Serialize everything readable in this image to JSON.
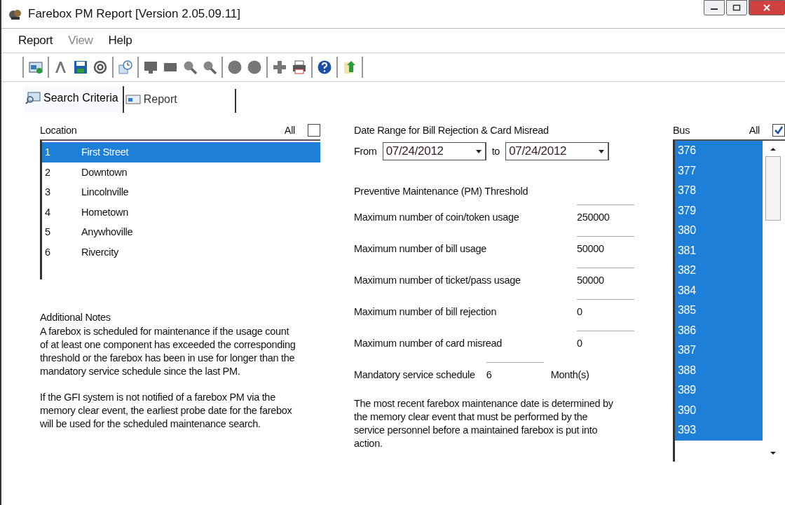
{
  "window": {
    "title": "Farebox PM Report [Version 2.05.09.11]"
  },
  "menu": [
    {
      "label": "Report",
      "disabled": false
    },
    {
      "label": "View",
      "disabled": true
    },
    {
      "label": "Help",
      "disabled": false
    }
  ],
  "tabs": [
    {
      "label": "Search Criteria",
      "selected": true
    },
    {
      "label": "Report",
      "selected": false
    }
  ],
  "location": {
    "label": "Location",
    "all_label": "All",
    "all_checked": false,
    "items": [
      {
        "number": "1",
        "name": "First Street",
        "selected": true
      },
      {
        "number": "2",
        "name": "Downtown",
        "selected": false
      },
      {
        "number": "3",
        "name": "Lincolnville",
        "selected": false
      },
      {
        "number": "4",
        "name": "Hometown",
        "selected": false
      },
      {
        "number": "5",
        "name": "Anywhoville",
        "selected": false
      },
      {
        "number": "6",
        "name": "Rivercity",
        "selected": false
      }
    ]
  },
  "notes": {
    "heading": "Additional Notes",
    "paragraphs": [
      "A farebox is scheduled for maintenance if the usage count of at least one component has exceeded the corresponding threshold or the farebox has been in use for longer than the mandatory service schedule since the last PM.",
      "If the GFI system is not notified of a farebox PM via the memory clear event, the earliest probe date for the farebox will be used for the scheduled maintenance search."
    ]
  },
  "date_range": {
    "label": "Date Range for Bill Rejection & Card Misread",
    "from_label": "From",
    "from": "07/24/2012",
    "to_label": "to",
    "to": "07/24/2012"
  },
  "threshold": {
    "heading": "Preventive Maintenance (PM) Threshold",
    "fields": [
      {
        "label": "Maximum number of coin/token usage",
        "value": "250000"
      },
      {
        "label": "Maximum number of bill usage",
        "value": "50000"
      },
      {
        "label": "Maximum number of ticket/pass usage",
        "value": "50000"
      },
      {
        "label": "Maximum number of bill rejection",
        "value": "0"
      },
      {
        "label": "Maximum number of card misread",
        "value": "0"
      }
    ],
    "schedule": {
      "label": "Mandatory service schedule",
      "value": "6",
      "unit": "Month(s)"
    },
    "note": "The most recent farebox maintenance date is determined by the memory clear event that must be performed by the service personnel before a maintained farebox is put into action."
  },
  "bus": {
    "label": "Bus",
    "all_label": "All",
    "all_checked": true,
    "items": [
      {
        "number": "376",
        "selected": true
      },
      {
        "number": "377",
        "selected": true
      },
      {
        "number": "378",
        "selected": true
      },
      {
        "number": "379",
        "selected": true
      },
      {
        "number": "380",
        "selected": true
      },
      {
        "number": "381",
        "selected": true
      },
      {
        "number": "382",
        "selected": true
      },
      {
        "number": "384",
        "selected": true
      },
      {
        "number": "385",
        "selected": true
      },
      {
        "number": "386",
        "selected": true
      },
      {
        "number": "387",
        "selected": true
      },
      {
        "number": "388",
        "selected": true
      },
      {
        "number": "389",
        "selected": true
      },
      {
        "number": "390",
        "selected": true
      },
      {
        "number": "393",
        "selected": true
      }
    ]
  }
}
